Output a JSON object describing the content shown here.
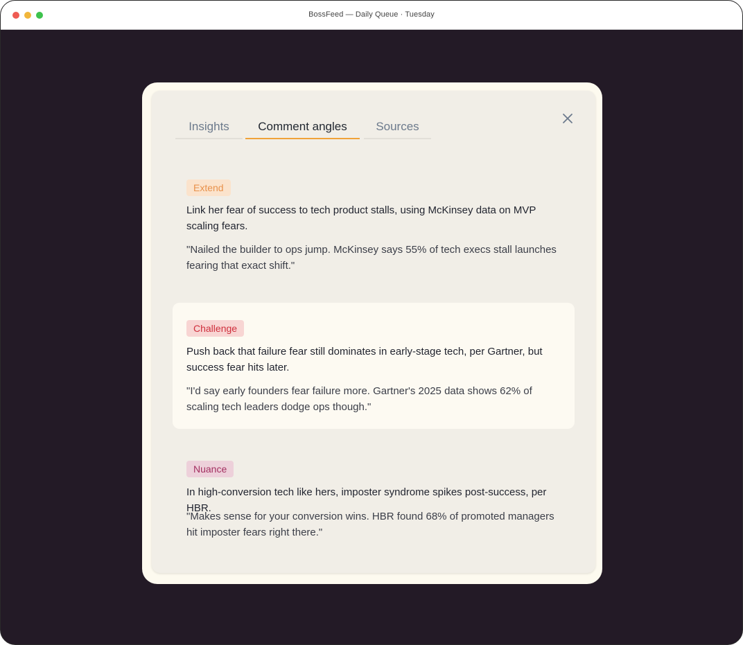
{
  "window": {
    "title": "BossFeed — Daily Queue · Tuesday"
  },
  "tabs": [
    {
      "label": "Insights",
      "active": false
    },
    {
      "label": "Comment angles",
      "active": true
    },
    {
      "label": "Sources",
      "active": false
    }
  ],
  "close_icon": "close-icon",
  "colors": {
    "background": "#231a26",
    "active_tab_underline": "#f0a239",
    "extend": "#e8914b",
    "challenge": "#cf2f3c",
    "nuance": "#a33061"
  },
  "angles": [
    {
      "tag": "Extend",
      "summary": "Link her fear of success to tech product stalls, using McKinsey data on MVP scaling fears.",
      "quote": "\"Nailed the builder to ops jump. McKinsey says 55% of tech execs stall launches fearing that exact shift.\""
    },
    {
      "tag": "Challenge",
      "summary": "Push back that failure fear still dominates in early-stage tech, per Gartner, but success fear hits later.",
      "quote": "\"I'd say early founders fear failure more. Gartner's 2025 data shows 62% of scaling tech leaders dodge ops though.\""
    },
    {
      "tag": "Nuance",
      "summary": "In high-conversion tech like hers, imposter syndrome spikes post-success, per HBR.",
      "quote": "\"Makes sense for your conversion wins. HBR found 68% of promoted managers hit imposter fears right there.\""
    }
  ]
}
